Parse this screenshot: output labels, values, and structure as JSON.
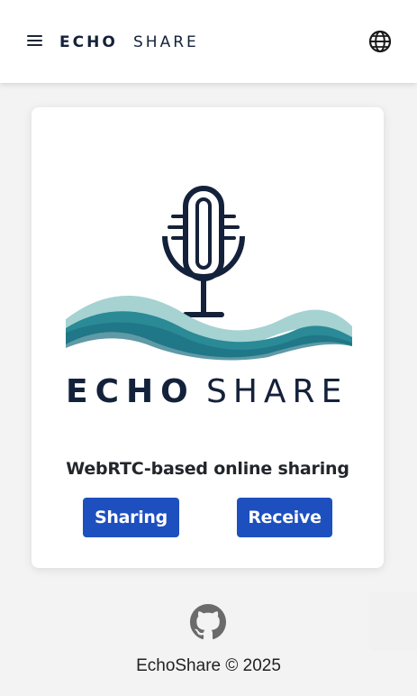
{
  "header": {
    "brand": {
      "bold": "ECHO",
      "light": "SHARE"
    },
    "menu_icon": "hamburger-menu-icon",
    "language_icon": "globe-icon"
  },
  "card": {
    "logo": {
      "bold": "ECHO",
      "light": "SHARE",
      "icon": "microphone-wave-logo"
    },
    "tagline": "WebRTC-based online sharing",
    "buttons": {
      "sharing": "Sharing",
      "receive": "Receive"
    }
  },
  "footer": {
    "github_icon": "github-icon",
    "copyright": "EchoShare © 2025"
  },
  "colors": {
    "primary_button": "#1d4fbf",
    "navy": "#14213a",
    "wave_teal": "#2a8a96",
    "wave_light": "#8fc6c6"
  }
}
